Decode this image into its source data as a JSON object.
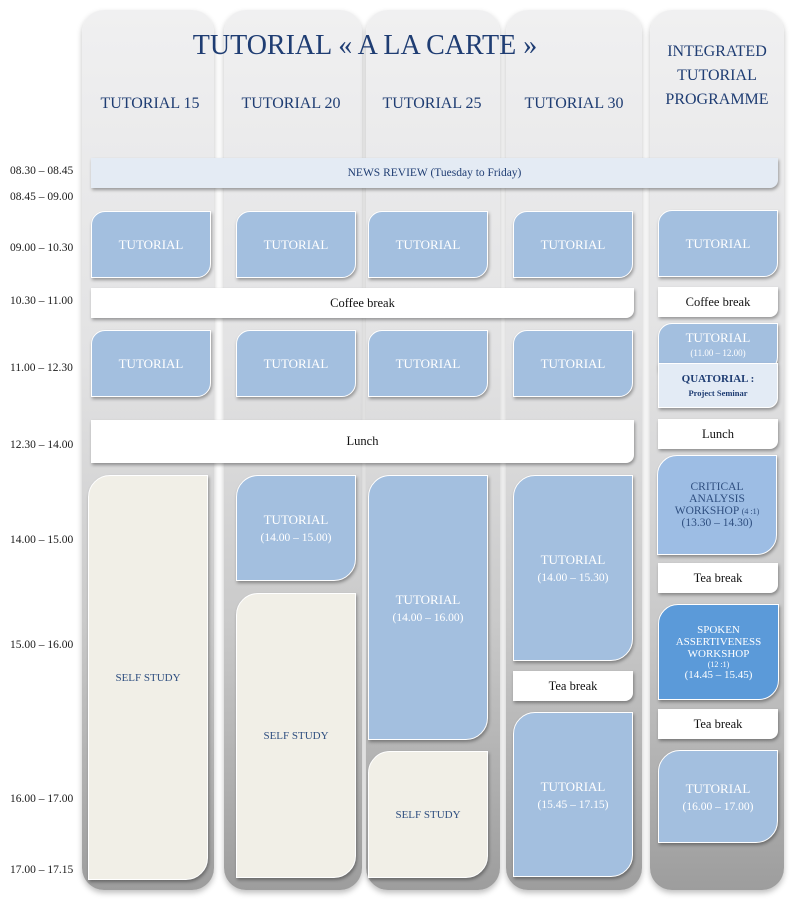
{
  "header": {
    "main_title": "TUTORIAL « A LA CARTE »",
    "columns": [
      "TUTORIAL 15",
      "TUTORIAL 20",
      "TUTORIAL 25",
      "TUTORIAL 30"
    ],
    "integrated": [
      "INTEGRATED",
      "TUTORIAL",
      "PROGRAMME"
    ]
  },
  "times": [
    "08.30 – 08.45",
    "08.45 – 09.00",
    "09.00 – 10.30",
    "10.30 – 11.00",
    "11.00 – 12.30",
    "12.30 – 14.00",
    "14.00 – 15.00",
    "15.00 – 16.00",
    "16.00 – 17.00",
    "17.00 – 17.15"
  ],
  "news": "NEWS REVIEW (Tuesday to Friday)",
  "labels": {
    "tutorial": "TUTORIAL",
    "coffee": "Coffee break",
    "lunch": "Lunch",
    "tea": "Tea break",
    "self_study": "SELF STUDY"
  },
  "slots": {
    "t20_afternoon": "(14.00 – 15.00)",
    "t25_afternoon": "(14.00 – 16.00)",
    "t30_afternoon1": "(14.00 – 15.30)",
    "t30_afternoon2": "(15.45 – 17.15)"
  },
  "integrated": {
    "tutorial_late": "(11.00 – 12.00)",
    "quatorial_title": "QUATORIAL :",
    "quatorial_sub": "Project Seminar",
    "critical": [
      "CRITICAL",
      "ANALYSIS",
      "WORKSHOP"
    ],
    "critical_ratio": "(4 :1)",
    "critical_time": "(13.30 – 14.30)",
    "spoken": [
      "SPOKEN",
      "ASSERTIVENESS",
      "WORKSHOP"
    ],
    "spoken_ratio": "(12 :1)",
    "spoken_time": "(14.45 – 15.45)",
    "tutorial_final_time": "(16.00 – 17.00)"
  }
}
